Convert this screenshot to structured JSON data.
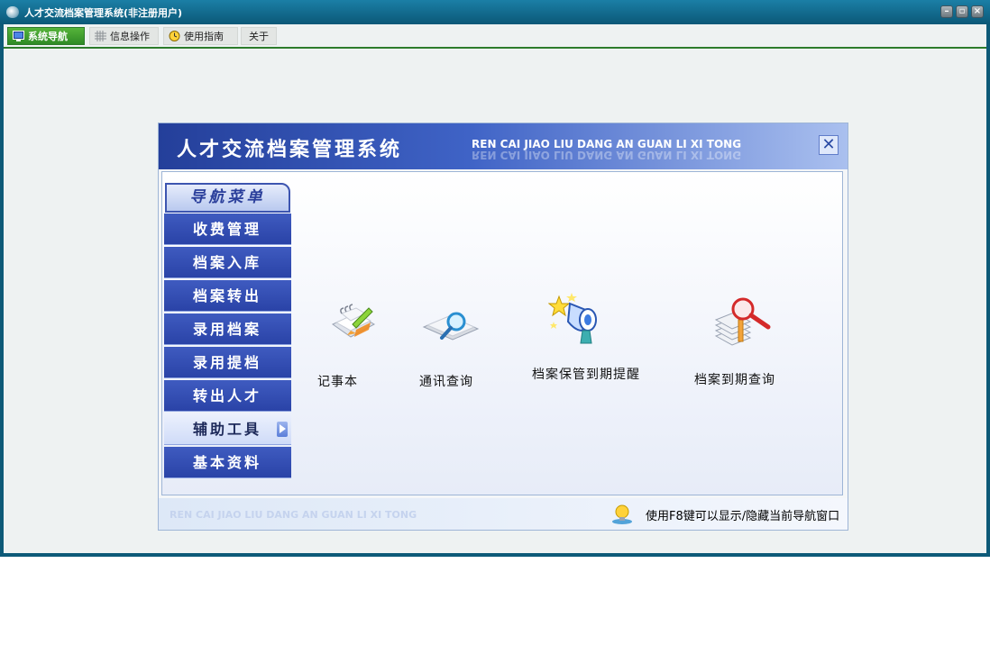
{
  "window": {
    "title": "人才交流档案管理系统(非注册用户)",
    "controls": [
      "minimize",
      "restore",
      "close"
    ]
  },
  "tabs": [
    {
      "label": "系统导航",
      "icon": "monitor-icon",
      "active": true
    },
    {
      "label": "信息操作",
      "icon": "grid-icon",
      "active": false
    },
    {
      "label": "使用指南",
      "icon": "clock-icon",
      "active": false
    },
    {
      "label": "关于",
      "icon": "",
      "active": false
    }
  ],
  "panel": {
    "title": "人才交流档案管理系统",
    "title_en": "REN CAI JIAO LIU DANG AN GUAN LI XI TONG",
    "close_glyph": "✕",
    "menu_header": "导航菜单",
    "menu": [
      {
        "label": "收费管理"
      },
      {
        "label": "档案入库"
      },
      {
        "label": "档案转出"
      },
      {
        "label": "录用档案"
      },
      {
        "label": "录用提档"
      },
      {
        "label": "转出人才"
      },
      {
        "label": "辅助工具",
        "selected": true
      },
      {
        "label": "基本资料"
      }
    ],
    "tools": [
      {
        "label": "记事本",
        "icon": "notepad-icon"
      },
      {
        "label": "通讯查询",
        "icon": "address-search-icon"
      },
      {
        "label": "档案保管到期提醒",
        "icon": "reminder-icon"
      },
      {
        "label": "档案到期查询",
        "icon": "file-search-icon"
      }
    ],
    "footer_en": "REN CAI JIAO LIU DANG AN GUAN LI XI TONG",
    "hint": "使用F8键可以显示/隐藏当前导航窗口"
  },
  "colors": {
    "accent_green": "#2d7c2b",
    "menu_blue": "#2a43a7",
    "frame": "#0d5a78"
  }
}
